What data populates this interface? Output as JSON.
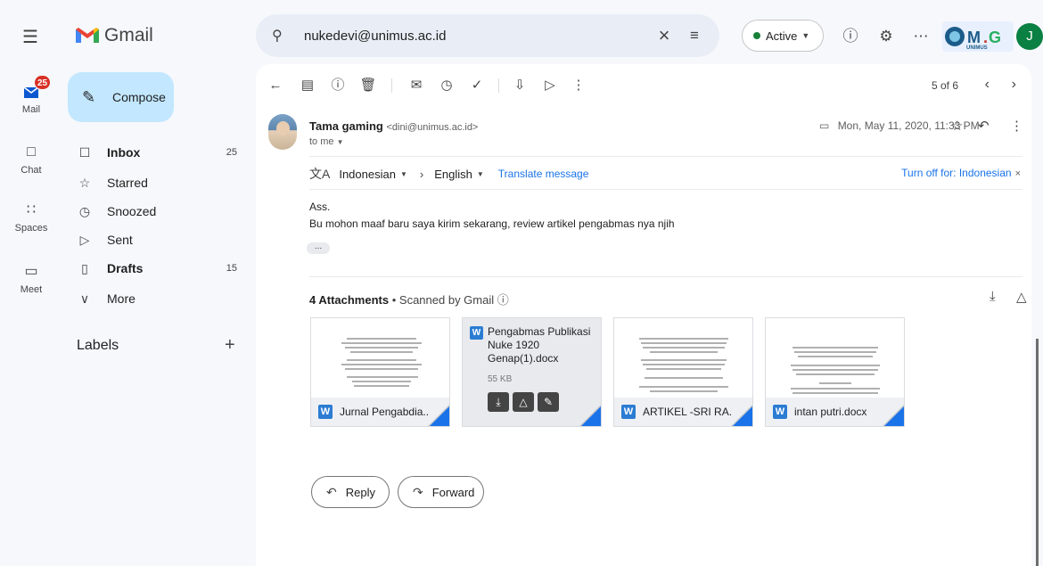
{
  "rail": {
    "mail_label": "Mail",
    "mail_badge": "25",
    "chat_label": "Chat",
    "spaces_label": "Spaces",
    "meet_label": "Meet"
  },
  "app": {
    "name": "Gmail"
  },
  "search": {
    "query": "nukedevi@unimus.ac.id"
  },
  "status": {
    "label": "Active"
  },
  "org_logo_text": "OMG UNIMUS",
  "account_initial": "J",
  "nav": {
    "compose": "Compose",
    "items": [
      {
        "label": "Inbox",
        "count": "25"
      },
      {
        "label": "Starred",
        "count": ""
      },
      {
        "label": "Snoozed",
        "count": ""
      },
      {
        "label": "Sent",
        "count": ""
      },
      {
        "label": "Drafts",
        "count": "15"
      },
      {
        "label": "More",
        "count": ""
      }
    ],
    "labels_heading": "Labels"
  },
  "toolbar": {
    "pager": "5 of 6"
  },
  "message": {
    "sender_name": "Tama gaming",
    "sender_email": "<dini@unimus.ac.id>",
    "to": "to me",
    "date": "Mon, May 11, 2020, 11:33 PM",
    "translate": {
      "from": "Indonesian",
      "to": "English",
      "action": "Translate message",
      "turn_off": "Turn off for: Indonesian"
    },
    "body": [
      "Ass.",
      "Bu mohon maaf baru saya kirim sekarang, review artikel pengabmas nya njih"
    ],
    "attachments_title": "4 Attachments",
    "scanned": "Scanned by Gmail",
    "attachments": [
      {
        "name": "Jurnal Pengabdia..."
      },
      {
        "name": "Pengabmas Publikasi Nuke 1920 Genap(1).docx",
        "size": "55 KB"
      },
      {
        "name": "ARTIKEL -SRI RA..."
      },
      {
        "name": "intan putri.docx"
      }
    ]
  },
  "actions": {
    "reply": "Reply",
    "forward": "Forward"
  },
  "colors": {
    "accent": "#1a73e8",
    "compose_bg": "#c2e7ff",
    "badge": "#d93025",
    "word": "#2b7cd3"
  }
}
